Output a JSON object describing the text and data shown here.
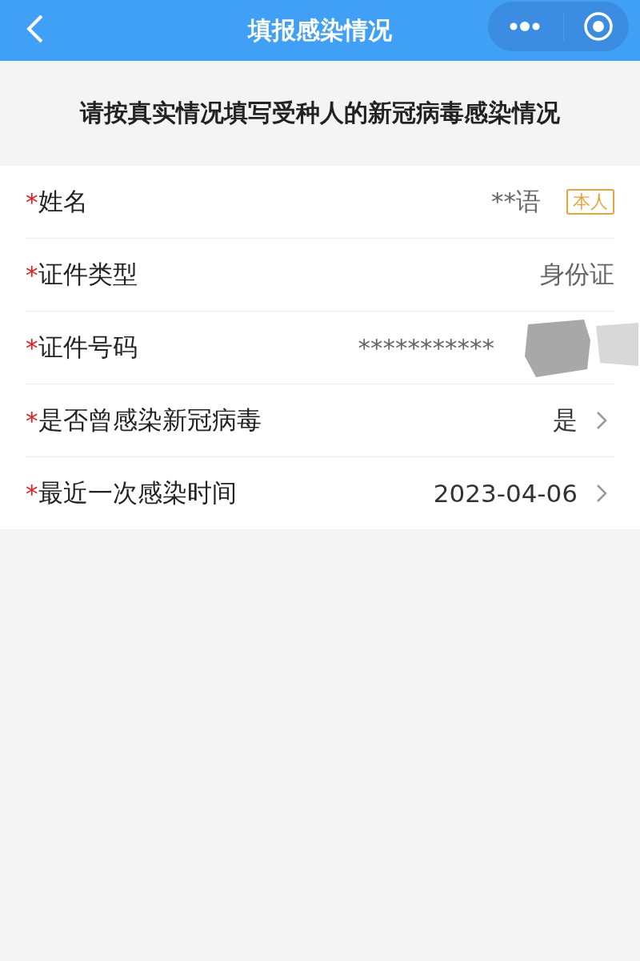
{
  "nav_bar": {
    "title": "填报感染情况"
  },
  "notice": "请按真实情况填写受种人的新冠病毒感染情况",
  "form_rows": [
    {
      "label": "姓名",
      "required_mark": "*",
      "value": "**语",
      "badge": "本人",
      "arrow": false,
      "redacted": false
    },
    {
      "label": "证件类型",
      "required_mark": "*",
      "value": "身份证",
      "arrow": false,
      "redacted": false
    },
    {
      "label": "证件号码",
      "required_mark": "*",
      "value": "***********",
      "arrow": false,
      "redacted": true
    },
    {
      "label": "是否曾感染新冠病毒",
      "required_mark": "*",
      "value": "是",
      "arrow": true,
      "redacted": false
    },
    {
      "label": "最近一次感染时间",
      "required_mark": "*",
      "value": "2023-04-06",
      "arrow": true,
      "redacted": false
    }
  ]
}
